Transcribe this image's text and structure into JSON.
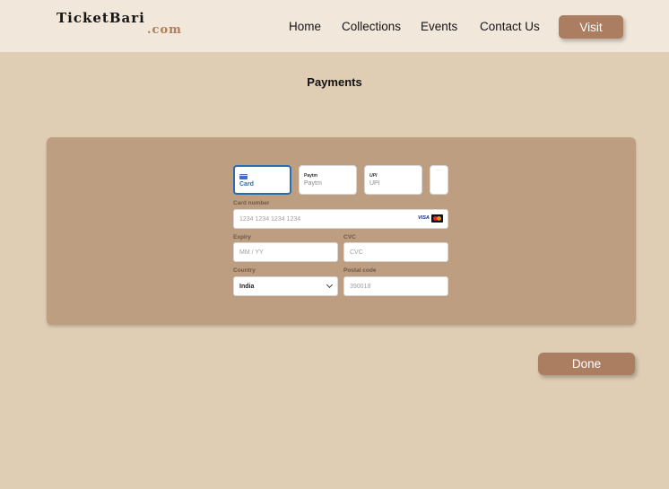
{
  "header": {
    "logo_name": "TicketBari",
    "logo_tld": ".com",
    "nav": [
      "Home",
      "Collections",
      "Events",
      "Contact Us"
    ],
    "visit_label": "Visit"
  },
  "page": {
    "title": "Payments"
  },
  "payment": {
    "tabs": [
      {
        "label": "Card",
        "icon": "credit-card-icon",
        "active": true
      },
      {
        "label": "Paytm",
        "icon_text": "Paytm",
        "icon": "paytm-icon",
        "active": false
      },
      {
        "label": "UPI",
        "icon_text": "UPI",
        "icon": "upi-icon",
        "active": false
      }
    ],
    "more_tabs_glyph": "···",
    "card_number": {
      "label": "Card number",
      "placeholder": "1234 1234 1234 1234"
    },
    "card_brands": {
      "visa": "VISA"
    },
    "expiry": {
      "label": "Expiry",
      "placeholder": "MM / YY"
    },
    "cvc": {
      "label": "CVC",
      "placeholder": "CVC"
    },
    "country": {
      "label": "Country",
      "value": "India"
    },
    "postal": {
      "label": "Postal code",
      "placeholder": "390018"
    },
    "accent_color": "#2b6cb0"
  },
  "actions": {
    "done_label": "Done"
  },
  "colors": {
    "background": "#dfcdb4",
    "header": "#f1e7da",
    "panel": "#bd9e81",
    "button": "#ab7e62"
  }
}
